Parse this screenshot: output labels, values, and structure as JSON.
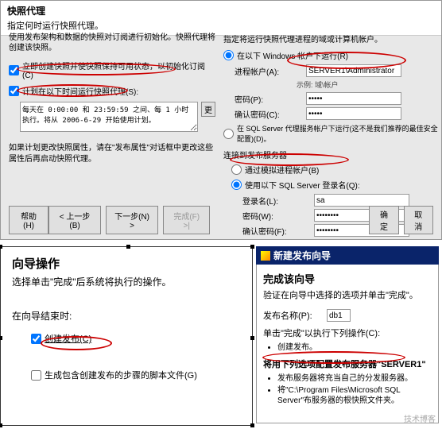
{
  "top": {
    "title": "快照代理",
    "subtitle": "指定何时运行快照代理。",
    "desc": "使用发布架构和数据的快照对订阅进行初始化。快照代理将创建该快照。",
    "chk1": "立即创建快照并使快照保持可用状态，以初始化订阅(C)",
    "chk2": "计划在以下时间运行快照代理(S):",
    "schedule": "每天在 0:00:00 和 23:59:59 之间、每 1 小时 执行。将从 2006-6-29 开始使用计划。",
    "change_btn": "更",
    "note": "如果计划更改快照属性，请在\"发布属性\"对话框中更改这些属性后再启动快照代理。"
  },
  "right": {
    "header": "指定将运行快照代理进程的域或计算机帐户。",
    "grp1": "在以下 Windows 帐户下运行(R)",
    "acct_label": "进程帐户(A):",
    "acct_value": "SERVER1\\Administrator",
    "acct_hint": "示例: 域\\帐户",
    "pwd_label": "密码(P):",
    "pwd_value": "•••••",
    "pwd2_label": "确认密码(C):",
    "pwd2_value": "•••••",
    "rad2": "在 SQL Server 代理服务帐户下运行(这不是我们推荐的最佳安全配置)(D)。",
    "section": "连接到发布服务器",
    "rad3": "通过模拟进程帐户(B)",
    "rad4": "使用以下 SQL Server 登录名(Q):",
    "login_label": "登录名(L):",
    "login_value": "sa",
    "pwd3_label": "密码(W):",
    "pwd4_label": "确认密码(F):",
    "pwd3_value": "••••••••"
  },
  "btns": {
    "help": "帮助(H)",
    "back": "< 上一步(B)",
    "next": "下一步(N) >",
    "finish": "完成(F) >|",
    "ok": "确定",
    "cancel": "取消"
  },
  "wizL": {
    "title": "向导操作",
    "sub": "选择单击\"完成\"后系统将执行的操作。",
    "label": "在向导结束时:",
    "opt1": "创建发布(C)",
    "opt2": "生成包含创建发布的步骤的脚本文件(G)"
  },
  "wizR": {
    "bar": "新建发布向导",
    "title": "完成该向导",
    "sub": "验证在向导中选择的选项并单击\"完成\"。",
    "name_label": "发布名称(P):",
    "name_value": "db1",
    "txt1": "单击\"完成\"以执行下列操作(C):",
    "li1": "创建发布。",
    "txt2": "将用下列选项配置发布服务器\"SERVER1\"",
    "li2": "发布服务器将充当自己的分发服务器。",
    "li3": "将\"C:\\Program Files\\Microsoft SQL Server\"布服务器的根快照文件夹。",
    "watermark": "技术博客"
  }
}
